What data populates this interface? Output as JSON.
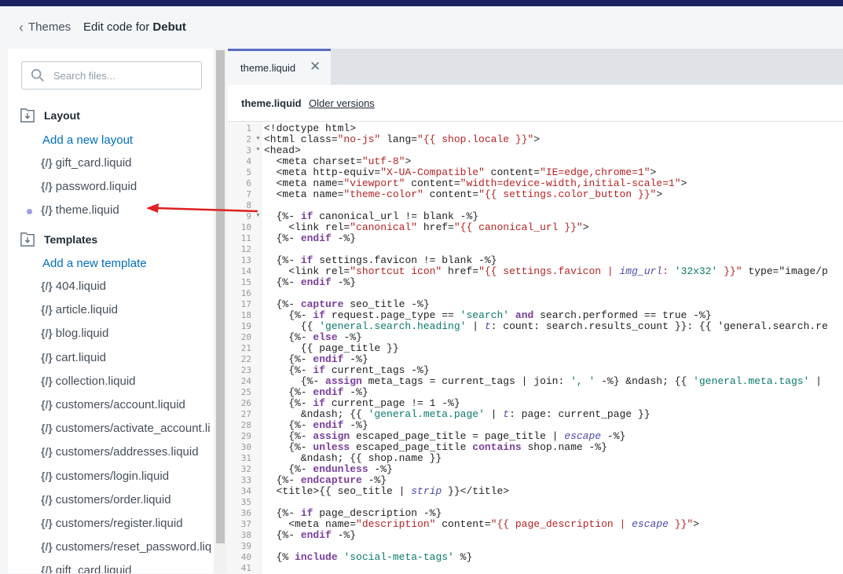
{
  "header": {
    "back_label": "Themes",
    "title_prefix": "Edit code for ",
    "title_theme": "Debut"
  },
  "sidebar": {
    "search_placeholder": "Search files...",
    "layout_label": "Layout",
    "add_layout": "Add a new layout",
    "layout_files": [
      "gift_card.liquid",
      "password.liquid",
      "theme.liquid"
    ],
    "templates_label": "Templates",
    "add_template": "Add a new template",
    "template_files": [
      "404.liquid",
      "article.liquid",
      "blog.liquid",
      "cart.liquid",
      "collection.liquid",
      "customers/account.liquid",
      "customers/activate_account.li",
      "customers/addresses.liquid",
      "customers/login.liquid",
      "customers/order.liquid",
      "customers/register.liquid",
      "customers/reset_password.liq",
      "gift_card.liquid"
    ],
    "file_icon": "{/}"
  },
  "editor": {
    "tab_label": "theme.liquid",
    "file_name": "theme.liquid",
    "older_versions": "Older versions"
  },
  "code_lines": [
    "<!doctype html>",
    "<html class=\"no-js\" lang=\"{{ shop.locale }}\">",
    "<head>",
    "  <meta charset=\"utf-8\">",
    "  <meta http-equiv=\"X-UA-Compatible\" content=\"IE=edge,chrome=1\">",
    "  <meta name=\"viewport\" content=\"width=device-width,initial-scale=1\">",
    "  <meta name=\"theme-color\" content=\"{{ settings.color_button }}\">",
    "",
    "  {%- if canonical_url != blank -%}",
    "    <link rel=\"canonical\" href=\"{{ canonical_url }}\">",
    "  {%- endif -%}",
    "",
    "  {%- if settings.favicon != blank -%}",
    "    <link rel=\"shortcut icon\" href=\"{{ settings.favicon | img_url: '32x32' }}\" type=\"image/p",
    "  {%- endif -%}",
    "",
    "  {%- capture seo_title -%}",
    "    {%- if request.page_type == 'search' and search.performed == true -%}",
    "      {{ 'general.search.heading' | t: count: search.results_count }}: {{ 'general.search.re",
    "    {%- else -%}",
    "      {{ page_title }}",
    "    {%- endif -%}",
    "    {%- if current_tags -%}",
    "      {%- assign meta_tags = current_tags | join: ', ' -%} &ndash; {{ 'general.meta.tags' |",
    "    {%- endif -%}",
    "    {%- if current_page != 1 -%}",
    "      &ndash; {{ 'general.meta.page' | t: page: current_page }}",
    "    {%- endif -%}",
    "    {%- assign escaped_page_title = page_title | escape -%}",
    "    {%- unless escaped_page_title contains shop.name -%}",
    "      &ndash; {{ shop.name }}",
    "    {%- endunless -%}",
    "  {%- endcapture -%}",
    "  <title>{{ seo_title | strip }}</title>",
    "",
    "  {%- if page_description -%}",
    "    <meta name=\"description\" content=\"{{ page_description | escape }}\">",
    "  {%- endif -%}",
    "",
    "  {% include 'social-meta-tags' %}",
    ""
  ],
  "fold_lines": [
    2,
    3,
    9
  ],
  "colors": {
    "accent": "#5c6ac4",
    "link": "#006fbb",
    "topbar": "#1c2260",
    "arrow": "#e02020"
  }
}
